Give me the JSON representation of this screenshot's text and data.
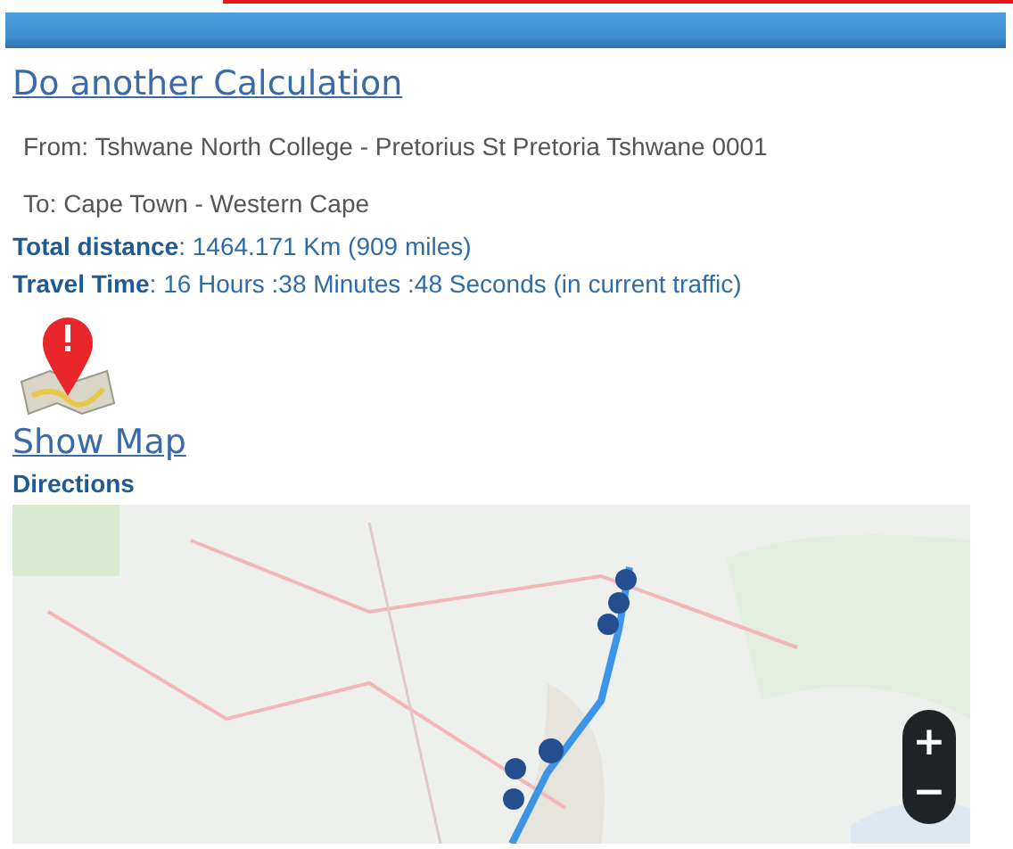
{
  "calculation_link": "Do another Calculation",
  "route": {
    "from": "From: Tshwane North College - Pretorius St Pretoria Tshwane 0001",
    "to": "To: Cape Town - Western Cape"
  },
  "summary": [
    {
      "label": "Total distance",
      "value": ": 1464.171 Km (909 miles)"
    },
    {
      "label": "Travel Time",
      "value": ": 16 Hours :38 Minutes :48 Seconds (in current traffic)"
    }
  ],
  "show_map_link": "Show Map",
  "directions_heading": "Directions",
  "map": {
    "kind": "picture",
    "zoom_controls": [
      "+",
      "−"
    ]
  }
}
